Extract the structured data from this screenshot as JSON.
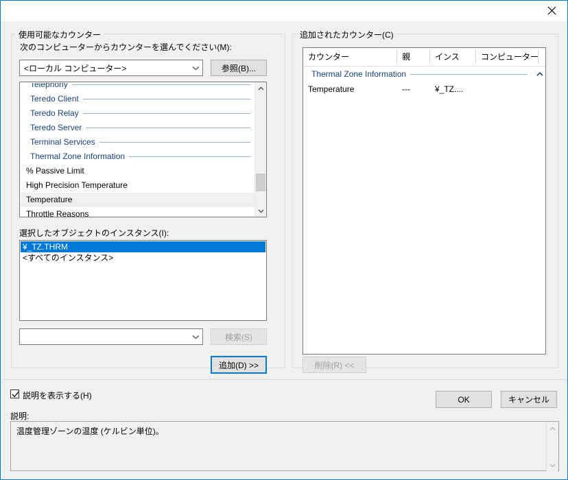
{
  "window": {
    "title": "",
    "close_icon": "close-icon"
  },
  "available_counters": {
    "group_label": "使用可能なカウンター",
    "computer_label": "次のコンピューターからカウンターを選んでください(M):",
    "computer_combo_value": "<ローカル コンピューター>",
    "computer_combo_placeholder": "",
    "browse_button": "参照(B)...",
    "counter_tree": [
      {
        "type": "category",
        "label": "Telephony",
        "expanded": false,
        "clipped": true
      },
      {
        "type": "category",
        "label": "Teredo Client",
        "expanded": false,
        "clipped": false
      },
      {
        "type": "category",
        "label": "Teredo Relay",
        "expanded": false,
        "clipped": false
      },
      {
        "type": "category",
        "label": "Teredo Server",
        "expanded": false,
        "clipped": false
      },
      {
        "type": "category",
        "label": "Terminal Services",
        "expanded": false,
        "clipped": false
      },
      {
        "type": "category",
        "label": "Thermal Zone Information",
        "expanded": true,
        "clipped": false
      },
      {
        "type": "counter",
        "label": "% Passive Limit",
        "highlighted": false
      },
      {
        "type": "counter",
        "label": "High Precision Temperature",
        "highlighted": false
      },
      {
        "type": "counter",
        "label": "Temperature",
        "highlighted": true
      },
      {
        "type": "counter",
        "label": "Throttle Reasons",
        "highlighted": false
      }
    ],
    "instances_label": "選択したオブジェクトのインスタンス(I):",
    "instances": [
      {
        "label": "¥_TZ.THRM",
        "selected": true
      },
      {
        "label": "<すべてのインスタンス>",
        "selected": false
      }
    ],
    "search_combo_value": "",
    "search_button": "検索(S)",
    "search_button_enabled": false,
    "add_button": "追加(D) >>"
  },
  "added_counters": {
    "group_label": "追加されたカウンター(C)",
    "columns": [
      "カウンター",
      "親",
      "インス",
      "コンピューター"
    ],
    "rows": [
      {
        "type": "group",
        "label": "Thermal Zone Information",
        "expanded": true
      },
      {
        "type": "data",
        "counter": "Temperature",
        "parent": "---",
        "instance": "¥_TZ....",
        "computer": ""
      }
    ],
    "remove_button": "削除(R) <<",
    "remove_button_enabled": false
  },
  "footer": {
    "show_description_label": "説明を表示する(H)",
    "show_description_checked": true,
    "description_label": "説明:",
    "description_text": "温度管理ゾーンの温度 (ケルビン単位)。",
    "ok_button": "OK",
    "cancel_button": "キャンセル"
  },
  "colors": {
    "accent": "#0078d7",
    "selection": "#0078d7",
    "category_text": "#14407f",
    "dialog_bg": "#f0f0f0"
  }
}
